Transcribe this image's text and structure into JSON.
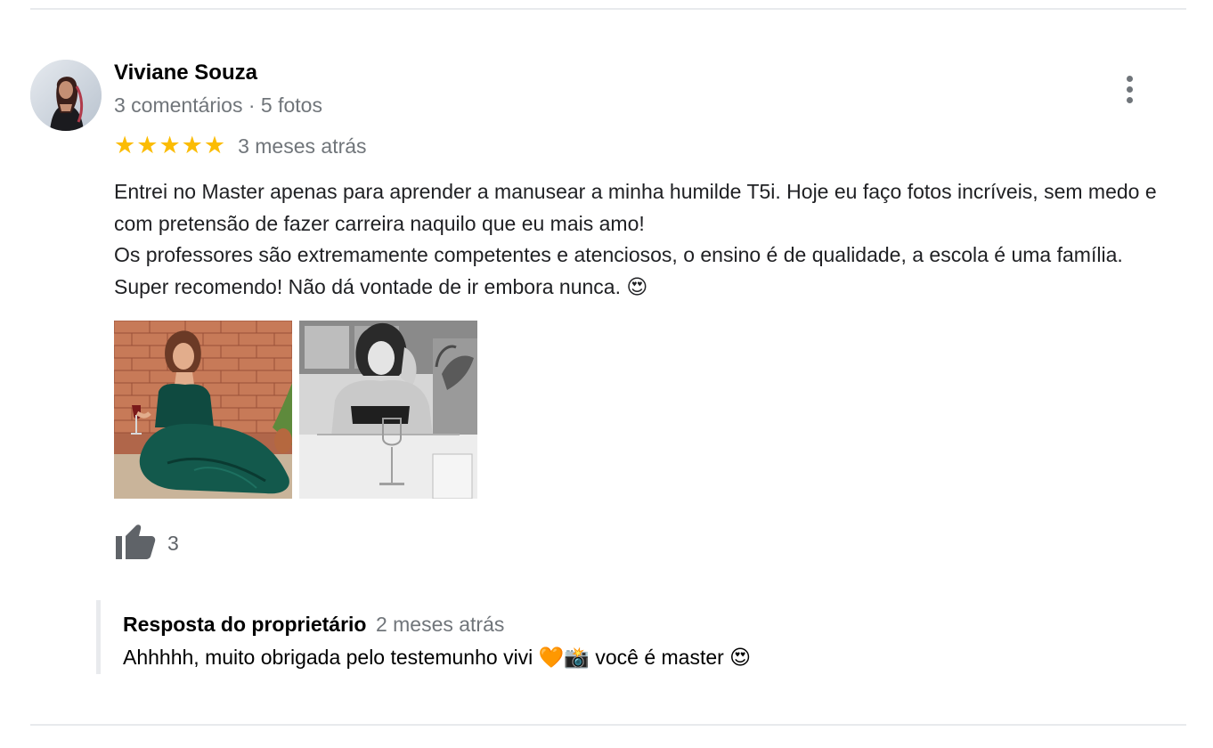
{
  "review": {
    "reviewer_name": "Viviane Souza",
    "reviewer_meta": "3 comentários · 5 fotos",
    "rating": 5,
    "stars": [
      "★",
      "★",
      "★",
      "★",
      "★"
    ],
    "date": "3 meses atrás",
    "text_line_1": "Entrei no Master apenas para aprender a manusear a minha humilde T5i. Hoje eu faço fotos incríveis, sem medo e com pretensão de fazer carreira naquilo que eu mais amo!",
    "text_line_2": "Os professores são extremamente competentes e atenciosos, o ensino é de qualidade, a escola é uma família. Super recomendo! Não dá vontade de ir embora nunca. 😍",
    "likes": "3",
    "photos": [
      "photo-woman-green-dress",
      "photo-woman-black-and-white"
    ]
  },
  "owner_reply": {
    "label": "Resposta do proprietário",
    "date": "2 meses atrás",
    "text": "Ahhhhh, muito obrigada pelo testemunho vivi 🧡📸 você é master 😍"
  },
  "icons": {
    "more": "more-vert-icon",
    "like": "thumb-up-icon",
    "star": "star-icon"
  },
  "colors": {
    "star": "#fbbc04",
    "meta_text": "#70757a",
    "divider": "#e8eaed"
  }
}
